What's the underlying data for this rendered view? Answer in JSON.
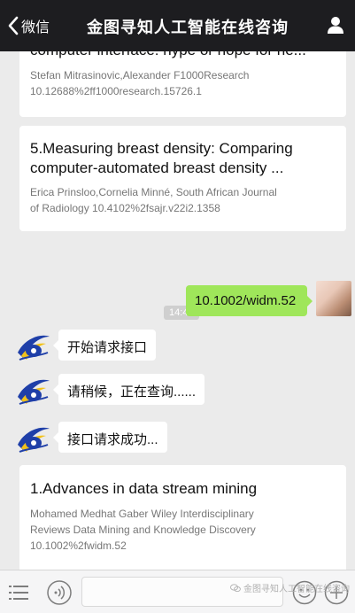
{
  "header": {
    "back_label": "微信",
    "title": "金图寻知人工智能在线咨询"
  },
  "cards": [
    {
      "title": "computer interface: hype or hope for ne...",
      "meta_line1": "Stefan Mitrasinovic,Alexander  F1000Research",
      "meta_line2": "10.12688%2ff1000research.15726.1"
    },
    {
      "title_line1": "5.Measuring breast density: Comparing",
      "title_line2": "computer-automated breast density ...",
      "meta_line1": "Erica Prinsloo,Cornelia Minné, South African Journal",
      "meta_line2": "of Radiology 10.4102%2fsajr.v22i2.1358"
    },
    {
      "title": "1.Advances in data stream mining",
      "meta_line1": "Mohamed Medhat Gaber Wiley Interdisciplinary",
      "meta_line2": "Reviews Data Mining and Knowledge Discovery",
      "meta_line3": "10.1002%2fwidm.52"
    }
  ],
  "timestamp": "14:45",
  "outgoing_message": "10.1002/widm.52",
  "bot_messages": [
    "开始请求接口",
    "请稍候，正在查询......",
    "接口请求成功..."
  ],
  "watermark": "金图寻知人工智能在线咨询",
  "colors": {
    "header_bg": "#1d1d20",
    "chat_bg": "#ebebeb",
    "outgoing_bubble": "#9fe65a"
  }
}
